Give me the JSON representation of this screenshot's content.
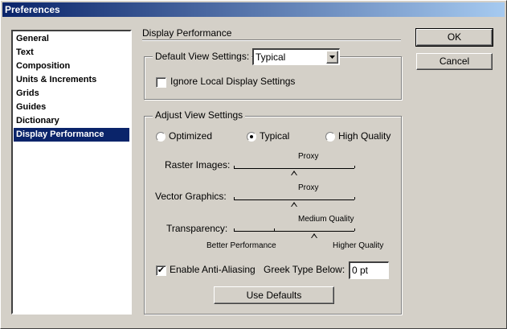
{
  "window": {
    "title": "Preferences"
  },
  "sidebar": {
    "items": [
      {
        "label": "General"
      },
      {
        "label": "Text"
      },
      {
        "label": "Composition"
      },
      {
        "label": "Units & Increments"
      },
      {
        "label": "Grids"
      },
      {
        "label": "Guides"
      },
      {
        "label": "Dictionary"
      },
      {
        "label": "Display Performance",
        "selected": true
      }
    ]
  },
  "panel": {
    "title": "Display Performance",
    "default_view": {
      "label": "Default View Settings:",
      "value": "Typical",
      "ignore_local_label": "Ignore Local Display Settings",
      "ignore_local_checked": false
    },
    "adjust": {
      "group_label": "Adjust View Settings",
      "radios": [
        {
          "label": "Optimized",
          "checked": false
        },
        {
          "label": "Typical",
          "checked": true
        },
        {
          "label": "High Quality",
          "checked": false
        }
      ],
      "sliders": [
        {
          "label": "Raster Images:",
          "value_label": "Proxy",
          "position_fraction": 0.5
        },
        {
          "label": "Vector Graphics:",
          "value_label": "Proxy",
          "position_fraction": 0.5
        },
        {
          "label": "Transparency:",
          "value_label": "Medium Quality",
          "position_fraction": 0.667
        }
      ],
      "scale_left": "Better Performance",
      "scale_right": "Higher Quality",
      "anti_alias_label": "Enable Anti-Aliasing",
      "anti_alias_checked": true,
      "greek_label": "Greek Type Below:",
      "greek_value": "0 pt",
      "use_defaults_label": "Use Defaults"
    }
  },
  "buttons": {
    "ok": "OK",
    "cancel": "Cancel"
  }
}
